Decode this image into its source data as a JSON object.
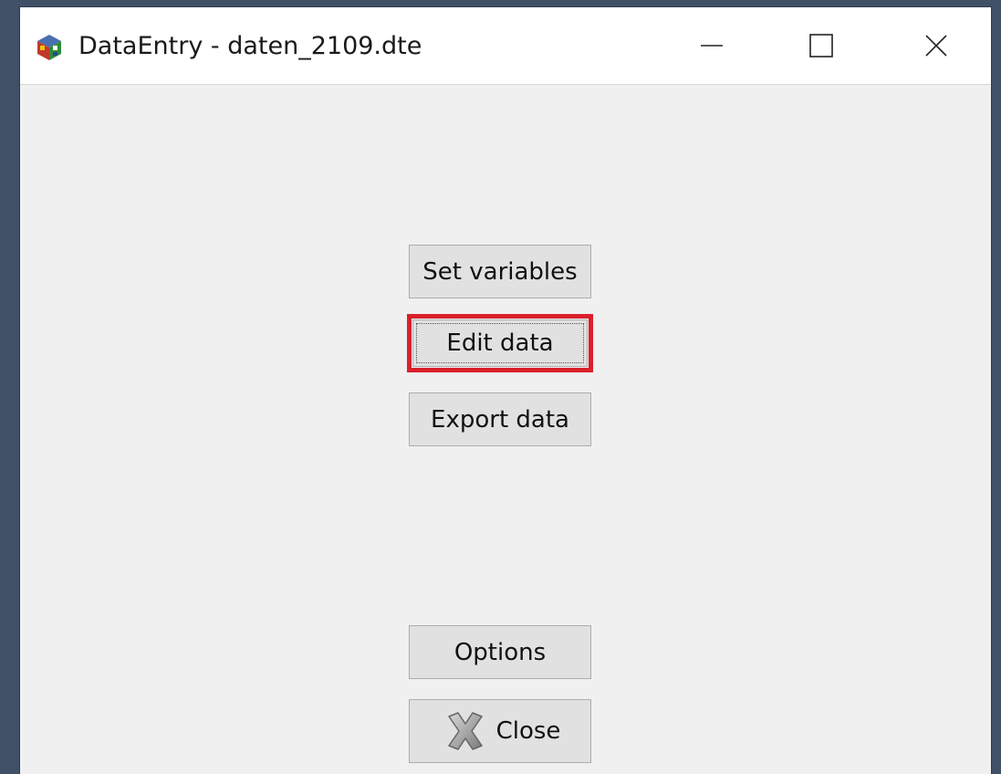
{
  "window": {
    "title": "DataEntry - daten_2109.dte"
  },
  "icons": {
    "app": "app-cube-icon",
    "minimize": "minimize-icon",
    "maximize": "maximize-icon",
    "close": "close-window-icon",
    "close_button": "close-x-icon"
  },
  "buttons": {
    "set_variables": "Set variables",
    "edit_data": "Edit data",
    "export_data": "Export data",
    "options": "Options",
    "close": "Close"
  },
  "highlight_color": "#d9202b"
}
